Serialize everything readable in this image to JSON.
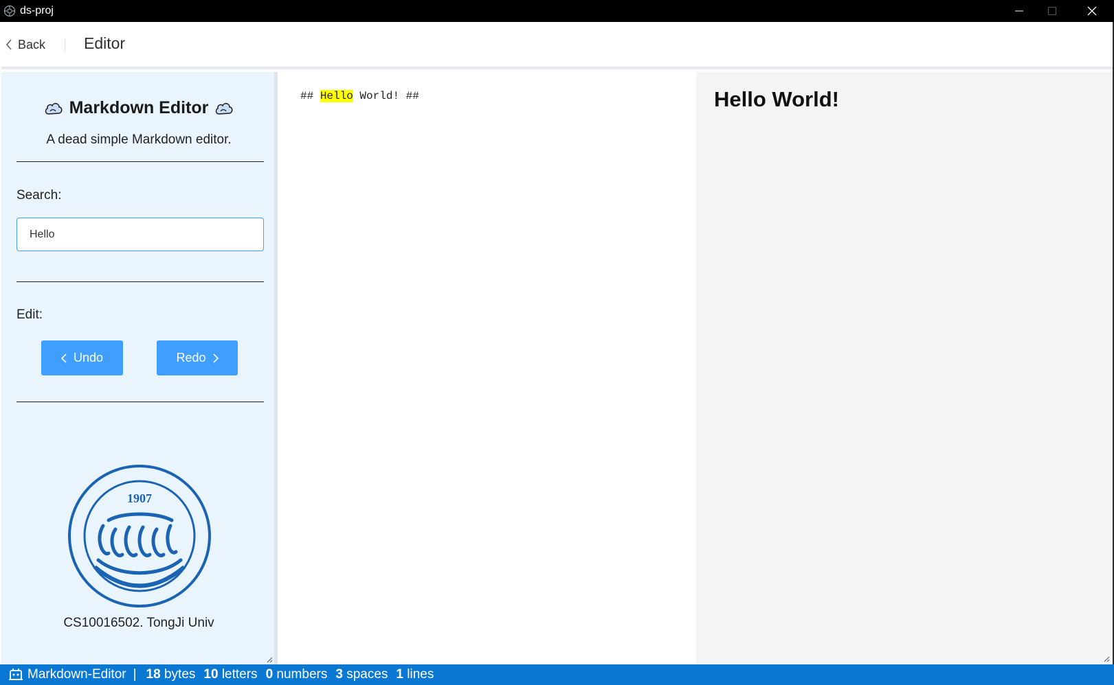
{
  "window": {
    "title": "ds-proj"
  },
  "header": {
    "back_label": "Back",
    "page_title": "Editor"
  },
  "sidebar": {
    "brand_title": "Markdown Editor",
    "subtitle": "A dead simple Markdown editor.",
    "search_label": "Search:",
    "search_value": "Hello",
    "edit_label": "Edit:",
    "undo_label": "Undo",
    "redo_label": "Redo",
    "logo_year": "1907",
    "footer": "CS10016502. TongJi Univ"
  },
  "editor": {
    "prefix": "## ",
    "highlight": "Hello",
    "suffix": " World! ##"
  },
  "preview": {
    "heading": "Hello World!"
  },
  "status": {
    "app_name": "Markdown-Editor",
    "separator": "|",
    "bytes_count": "18",
    "bytes_label": "bytes",
    "letters_count": "10",
    "letters_label": "letters",
    "numbers_count": "0",
    "numbers_label": "numbers",
    "spaces_count": "3",
    "spaces_label": "spaces",
    "lines_count": "1",
    "lines_label": "lines"
  },
  "colors": {
    "accent": "#409eff",
    "statusbar": "#0a78d2",
    "sidebar_bg": "#eaf4fd",
    "highlight": "#ffff00",
    "logo_blue": "#1b64b4"
  }
}
